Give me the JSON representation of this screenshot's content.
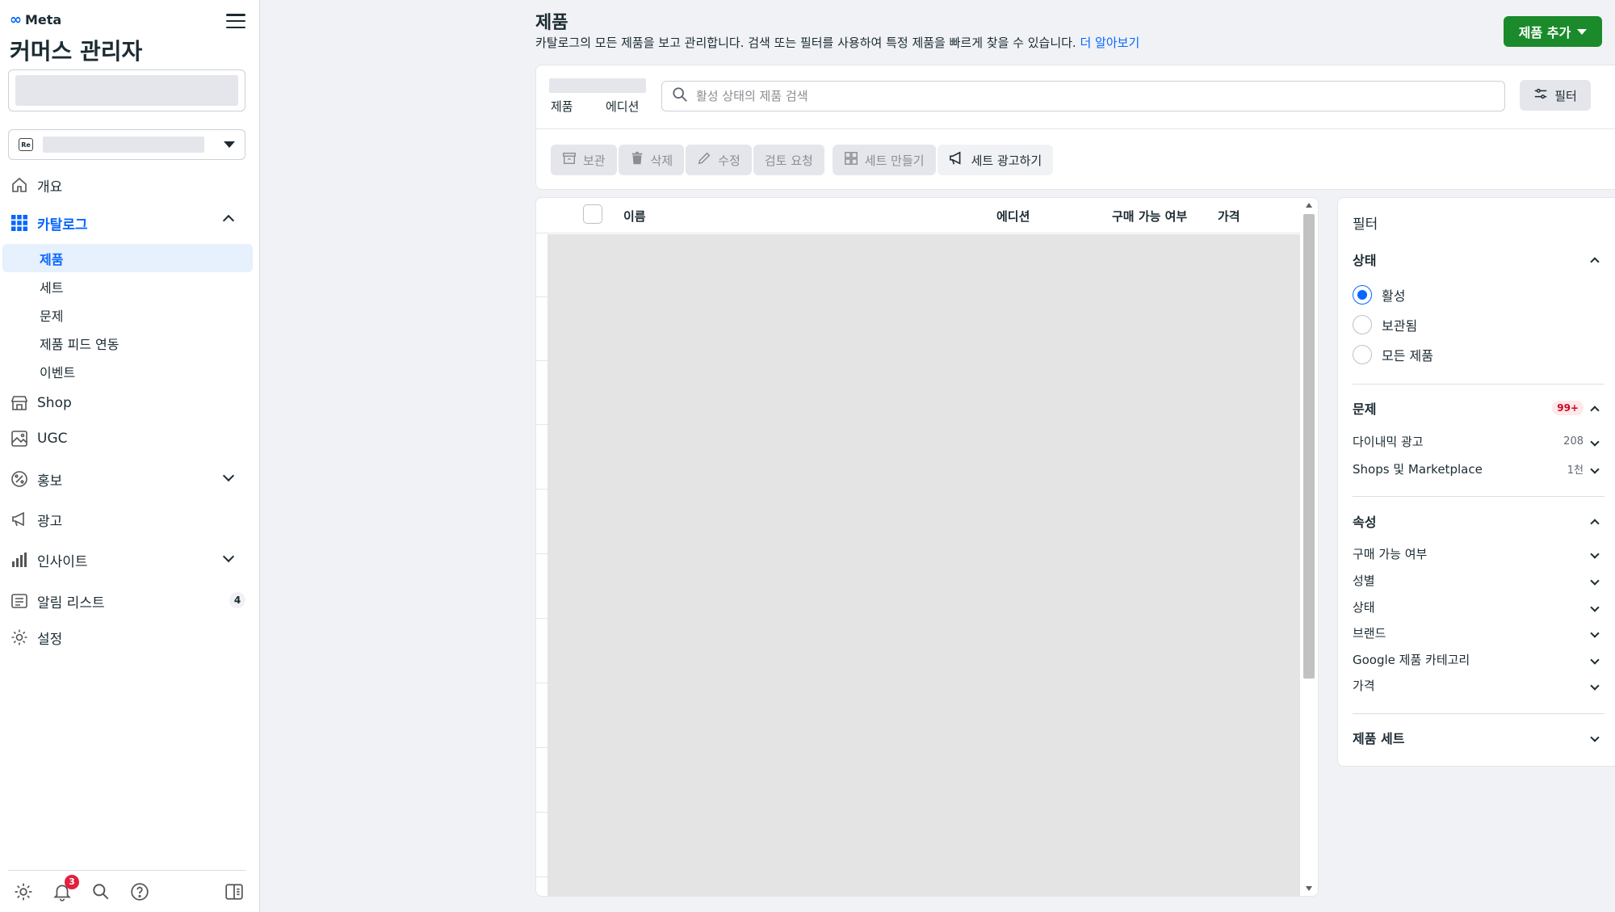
{
  "sidebar": {
    "brand": "Meta",
    "title": "커머스 관리자",
    "biz_badge": "Re",
    "nav": {
      "overview": "개요",
      "catalog": "카탈로그",
      "catalog_sub": [
        "제품",
        "세트",
        "문제",
        "제품 피드 연동",
        "이벤트"
      ],
      "shop": "Shop",
      "ugc": "UGC",
      "promo": "홍보",
      "ads": "광고",
      "insights": "인사이트",
      "alerts": "알림 리스트",
      "alerts_count": "4",
      "settings": "설정"
    },
    "footer": {
      "notif_count": "3"
    }
  },
  "header": {
    "title": "제품",
    "desc": "카탈로그의 모든 제품을 보고 관리합니다. 검색 또는 필터를 사용하여 특정 제품을 빠르게 찾을 수 있습니다.",
    "learn_more": "더 알아보기",
    "add_button": "제품 추가"
  },
  "tabs": [
    "제품",
    "에디션"
  ],
  "search": {
    "placeholder": "활성 상태의 제품 검색"
  },
  "filter_button": "필터",
  "toolbar": {
    "archive": "보관",
    "delete": "삭제",
    "edit": "수정",
    "review": "검토 요청",
    "make_set": "세트 만들기",
    "promote_set": "세트 광고하기"
  },
  "table": {
    "columns": [
      "이름",
      "에디션",
      "구매 가능 여부",
      "가격"
    ]
  },
  "filter_panel": {
    "title": "필터",
    "status": {
      "label": "상태",
      "options": [
        "활성",
        "보관됨",
        "모든 제품"
      ],
      "selected": "활성"
    },
    "issues": {
      "label": "문제",
      "badge": "99+",
      "items": [
        {
          "label": "다이내믹 광고",
          "count": "208"
        },
        {
          "label": "Shops 및 Marketplace",
          "count": "1천"
        }
      ]
    },
    "attributes": {
      "label": "속성",
      "items": [
        "구매 가능 여부",
        "성별",
        "상태",
        "브랜드",
        "Google 제품 카테고리",
        "가격"
      ]
    },
    "product_sets": {
      "label": "제품 세트"
    }
  },
  "colors": {
    "accent": "#0866ff",
    "primary_button": "#1b8a2b",
    "badge_red": "#e41e3f"
  }
}
